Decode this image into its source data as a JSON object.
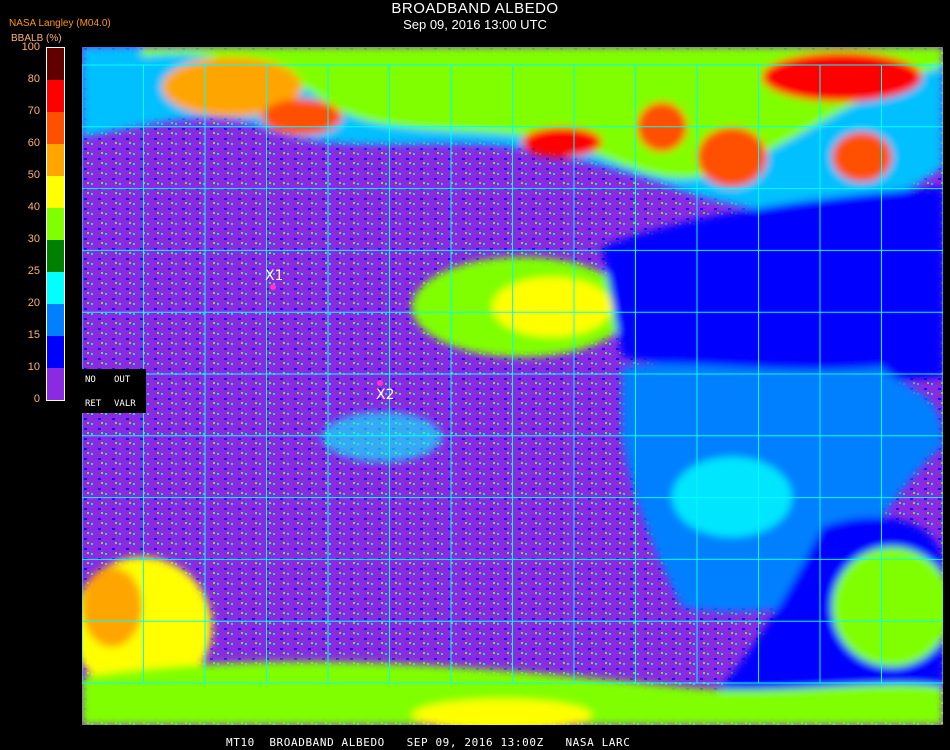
{
  "header": {
    "title": "BROADBAND ALBEDO",
    "subtitle": "Sep 09, 2016 13:00 UTC",
    "org": "NASA Langley (M04.0)"
  },
  "colorbar": {
    "unit_label": "BBALB (%)",
    "ticks": [
      "0",
      "10",
      "15",
      "20",
      "25",
      "30",
      "40",
      "50",
      "60",
      "70",
      "80",
      "100"
    ],
    "colors": [
      "#8a2be2",
      "#0000ff",
      "#0080ff",
      "#00ffff",
      "#008000",
      "#80ff00",
      "#ffff00",
      "#ffa500",
      "#ff5000",
      "#ff0000",
      "#600000"
    ]
  },
  "status_box": {
    "no": "NO",
    "out": "OUT",
    "ret": "RET",
    "valr": "VALR"
  },
  "markers": [
    {
      "label": "X1"
    },
    {
      "label": "X2"
    }
  ],
  "footer": "MT10  BROADBAND ALBEDO   SEP 09, 2016 13:00Z   NASA LARC"
}
